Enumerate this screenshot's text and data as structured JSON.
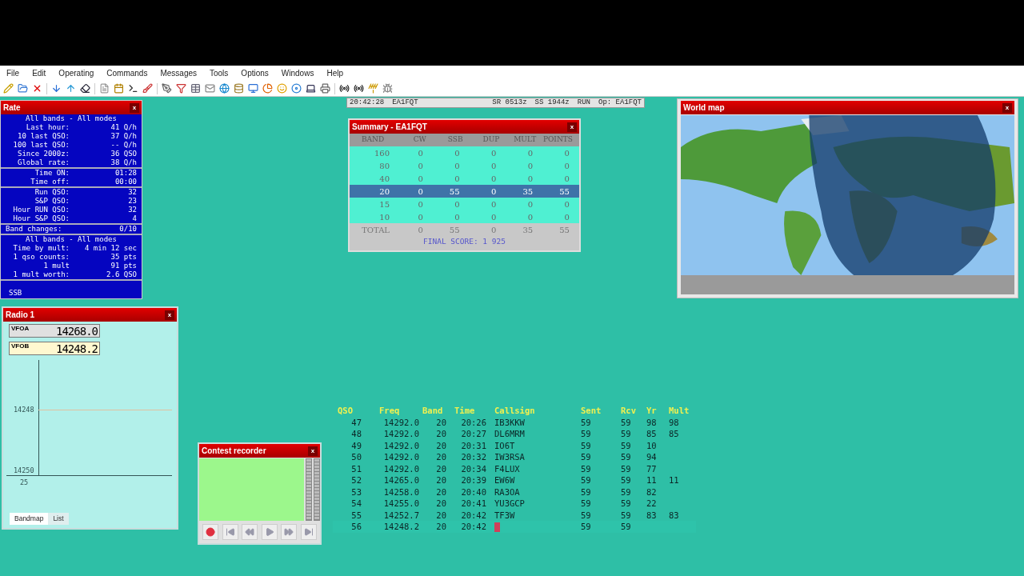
{
  "menu": [
    "File",
    "Edit",
    "Operating",
    "Commands",
    "Messages",
    "Tools",
    "Options",
    "Windows",
    "Help"
  ],
  "status_bar": [
    "20:42:28",
    "EA1FQT",
    "SR 0513z",
    "SS 1944z",
    "RUN",
    "Op: EA1FQT"
  ],
  "rate": {
    "title": "Rate",
    "close": "x",
    "sections": [
      {
        "heading": "All bands - All modes",
        "rows": [
          {
            "label": "Last hour:",
            "value": "41 Q/h"
          },
          {
            "label": "10 last QSO:",
            "value": "37 Q/h"
          },
          {
            "label": "100 last QSO:",
            "value": "-- Q/h"
          },
          {
            "label": "Since 2000z:",
            "value": "36 QSO"
          },
          {
            "label": "Global rate:",
            "value": "38 Q/h"
          }
        ]
      },
      {
        "rows": [
          {
            "label": "Time ON:",
            "value": "01:28"
          },
          {
            "label": "Time off:",
            "value": "00:00"
          }
        ]
      },
      {
        "rows": [
          {
            "label": "Run QSO:",
            "value": "32"
          },
          {
            "label": "S&P QSO:",
            "value": "23"
          },
          {
            "label": "Hour RUN QSO:",
            "value": "32"
          },
          {
            "label": "Hour S&P QSO:",
            "value": "4"
          }
        ]
      },
      {
        "rows": [
          {
            "label": "Band changes:",
            "value": "0/10"
          }
        ]
      },
      {
        "heading": "All bands - All modes",
        "rows": [
          {
            "label": "Time by mult:",
            "value": "4 min 12 sec"
          },
          {
            "label": "1 qso counts:",
            "value": "35 pts"
          },
          {
            "label": "1 mult",
            "value": "91 pts"
          },
          {
            "label": "1 mult worth:",
            "value": "2.6 QSO"
          }
        ]
      }
    ],
    "footer": "SSB"
  },
  "summary": {
    "title": "Summary - EA1FQT",
    "close": "x",
    "columns": [
      "BAND",
      "CW",
      "SSB",
      "DUP",
      "MULT",
      "POINTS"
    ],
    "rows": [
      {
        "cells": [
          "160",
          "0",
          "0",
          "0",
          "0",
          "0"
        ],
        "selected": false
      },
      {
        "cells": [
          "80",
          "0",
          "0",
          "0",
          "0",
          "0"
        ],
        "selected": false
      },
      {
        "cells": [
          "40",
          "0",
          "0",
          "0",
          "0",
          "0"
        ],
        "selected": false
      },
      {
        "cells": [
          "20",
          "0",
          "55",
          "0",
          "35",
          "55"
        ],
        "selected": true
      },
      {
        "cells": [
          "15",
          "0",
          "0",
          "0",
          "0",
          "0"
        ],
        "selected": false
      },
      {
        "cells": [
          "10",
          "0",
          "0",
          "0",
          "0",
          "0"
        ],
        "selected": false
      }
    ],
    "total": [
      "TOTAL",
      "0",
      "55",
      "0",
      "35",
      "55"
    ],
    "final_score": "FINAL SCORE: 1 925"
  },
  "world_map": {
    "title": "World map",
    "close": "x"
  },
  "radio": {
    "title": "Radio 1",
    "close": "x",
    "vfos": [
      {
        "label": "VFOA",
        "frequency": "14268.0",
        "selected": false
      },
      {
        "label": "VFOB",
        "frequency": "14248.2",
        "selected": true
      }
    ],
    "scale": [
      "14248",
      "14250"
    ],
    "footer_label": "25",
    "tabs": [
      {
        "label": "Bandmap",
        "selected": true
      },
      {
        "label": "List",
        "selected": false
      }
    ]
  },
  "recorder": {
    "title": "Contest recorder",
    "close": "x"
  },
  "log": {
    "columns": [
      "QSO",
      "Freq",
      "Band",
      "Time",
      "Callsign",
      "Sent",
      "Rcv",
      "Yr",
      "Mult"
    ],
    "rows": [
      {
        "cells": [
          "47",
          "14292.0",
          "20",
          "20:26",
          "IB3KKW",
          "59",
          "59",
          "98",
          "98"
        ],
        "editing": false
      },
      {
        "cells": [
          "48",
          "14292.0",
          "20",
          "20:27",
          "DL6MRM",
          "59",
          "59",
          "85",
          "85"
        ],
        "editing": false
      },
      {
        "cells": [
          "49",
          "14292.0",
          "20",
          "20:31",
          "IO6T",
          "59",
          "59",
          "10",
          ""
        ],
        "editing": false
      },
      {
        "cells": [
          "50",
          "14292.0",
          "20",
          "20:32",
          "IW3RSA",
          "59",
          "59",
          "94",
          ""
        ],
        "editing": false
      },
      {
        "cells": [
          "51",
          "14292.0",
          "20",
          "20:34",
          "F4LUX",
          "59",
          "59",
          "77",
          ""
        ],
        "editing": false
      },
      {
        "cells": [
          "52",
          "14265.0",
          "20",
          "20:39",
          "EW6W",
          "59",
          "59",
          "11",
          "11"
        ],
        "editing": false
      },
      {
        "cells": [
          "53",
          "14258.0",
          "20",
          "20:40",
          "RA3OA",
          "59",
          "59",
          "82",
          ""
        ],
        "editing": false
      },
      {
        "cells": [
          "54",
          "14255.0",
          "20",
          "20:41",
          "YU3GCP",
          "59",
          "59",
          "22",
          ""
        ],
        "editing": false
      },
      {
        "cells": [
          "55",
          "14252.7",
          "20",
          "20:42",
          "TF3W",
          "59",
          "59",
          "83",
          "83"
        ],
        "editing": false
      },
      {
        "cells": [
          "56",
          "14248.2",
          "20",
          "20:42",
          "",
          "59",
          "59",
          "",
          ""
        ],
        "editing": true
      }
    ]
  }
}
